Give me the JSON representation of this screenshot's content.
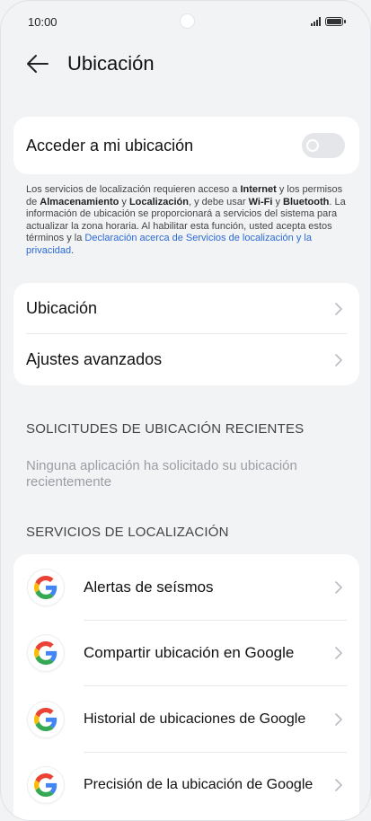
{
  "status_bar": {
    "time": "10:00"
  },
  "header": {
    "title": "Ubicación"
  },
  "location_toggle": {
    "label": "Acceder a mi ubicación",
    "state": "off"
  },
  "note": {
    "p1": "Los servicios de localización requieren acceso a ",
    "internet": "Internet",
    "p2": " y los permisos de ",
    "almacenamiento": "Almacenamiento",
    "p3": " y ",
    "localizacion": "Localización",
    "p4": ", y debe usar ",
    "wifi": "Wi-Fi",
    "p5": " y ",
    "bluetooth": "Bluetooth",
    "p6": ". La información de ubicación se proporcionará a servicios del sistema para actualizar la zona horaria. Al habilitar esta función, usted acepta estos términos y la ",
    "link": "Declaración acerca de Servicios de localización y la privacidad",
    "p7": "."
  },
  "settings": [
    {
      "label": "Ubicación"
    },
    {
      "label": "Ajustes avanzados"
    }
  ],
  "recent_requests": {
    "heading": "SOLICITUDES DE UBICACIÓN RECIENTES",
    "empty_text": "Ninguna aplicación ha solicitado su ubicación recientemente"
  },
  "services": {
    "heading": "SERVICIOS DE LOCALIZACIÓN",
    "items": [
      {
        "label": "Alertas de seísmos"
      },
      {
        "label": "Compartir ubicación en Google"
      },
      {
        "label": "Historial de ubicaciones de Google"
      },
      {
        "label": "Precisión de la ubicación de Google"
      }
    ]
  },
  "colors": {
    "accent_link": "#2c6ad8",
    "background": "#f1f3f5"
  }
}
